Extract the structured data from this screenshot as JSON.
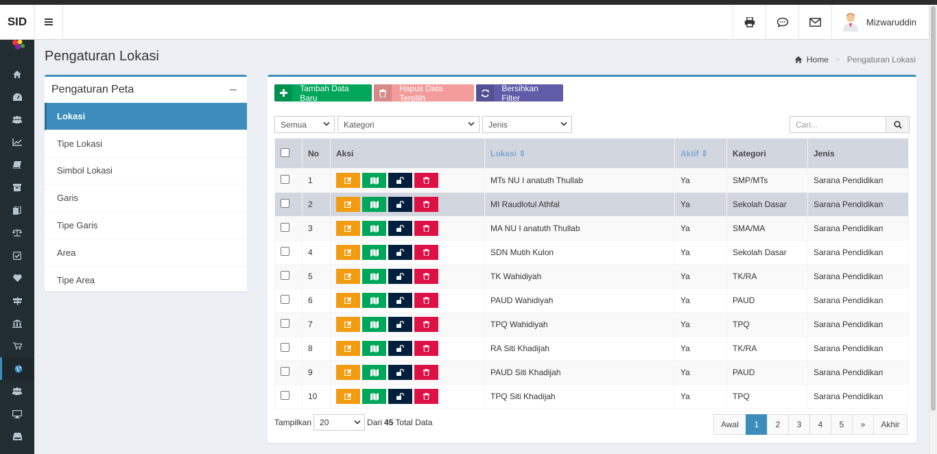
{
  "app": {
    "brand": "SID"
  },
  "user": {
    "name": "Mizwaruddin"
  },
  "page": {
    "title": "Pengaturan Lokasi"
  },
  "breadcrumb": {
    "home": "Home",
    "current": "Pengaturan Lokasi"
  },
  "left_panel": {
    "title": "Pengaturan Peta",
    "items": [
      {
        "label": "Lokasi",
        "active": true
      },
      {
        "label": "Tipe Lokasi"
      },
      {
        "label": "Simbol Lokasi"
      },
      {
        "label": "Garis"
      },
      {
        "label": "Tipe Garis"
      },
      {
        "label": "Area"
      },
      {
        "label": "Tipe Area"
      }
    ]
  },
  "toolbar": {
    "add_label": "Tambah Data Baru",
    "delete_label": "Hapus Data Terpilih",
    "clear_label": "Bersihkan Filter"
  },
  "filters": {
    "status": "Semua",
    "kategori": "Kategori",
    "jenis": "Jenis",
    "search_placeholder": "Cari..."
  },
  "table": {
    "headers": {
      "no": "No",
      "aksi": "Aksi",
      "lokasi": "Lokasi",
      "aktif": "Aktif",
      "kategori": "Kategori",
      "jenis": "Jenis"
    },
    "rows": [
      {
        "no": "1",
        "lokasi": "MTs NU I anatuth Thullab",
        "aktif": "Ya",
        "kategori": "SMP/MTs",
        "jenis": "Sarana Pendidikan"
      },
      {
        "no": "2",
        "lokasi": "MI Raudlotul Athfal",
        "aktif": "Ya",
        "kategori": "Sekolah Dasar",
        "jenis": "Sarana Pendidikan"
      },
      {
        "no": "3",
        "lokasi": "MA NU I anatuth Thullab",
        "aktif": "Ya",
        "kategori": "SMA/MA",
        "jenis": "Sarana Pendidikan"
      },
      {
        "no": "4",
        "lokasi": "SDN Mutih Kulon",
        "aktif": "Ya",
        "kategori": "Sekolah Dasar",
        "jenis": "Sarana Pendidikan"
      },
      {
        "no": "5",
        "lokasi": "TK Wahidiyah",
        "aktif": "Ya",
        "kategori": "TK/RA",
        "jenis": "Sarana Pendidikan"
      },
      {
        "no": "6",
        "lokasi": "PAUD Wahidiyah",
        "aktif": "Ya",
        "kategori": "PAUD",
        "jenis": "Sarana Pendidikan"
      },
      {
        "no": "7",
        "lokasi": "TPQ Wahidiyah",
        "aktif": "Ya",
        "kategori": "TPQ",
        "jenis": "Sarana Pendidikan"
      },
      {
        "no": "8",
        "lokasi": "RA Siti Khadijah",
        "aktif": "Ya",
        "kategori": "TK/RA",
        "jenis": "Sarana Pendidikan"
      },
      {
        "no": "9",
        "lokasi": "PAUD Siti Khadijah",
        "aktif": "Ya",
        "kategori": "PAUD",
        "jenis": "Sarana Pendidikan"
      },
      {
        "no": "10",
        "lokasi": "TPQ Siti Khadijah",
        "aktif": "Ya",
        "kategori": "TPQ",
        "jenis": "Sarana Pendidikan"
      }
    ]
  },
  "footer": {
    "show_label": "Tampilkan",
    "page_size": "20",
    "of_label": "Dari",
    "total": "45",
    "total_suffix": "Total Data"
  },
  "pagination": {
    "first": "Awal",
    "pages": [
      "1",
      "2",
      "3",
      "4",
      "5"
    ],
    "current": "1",
    "next": "»",
    "last": "Akhir"
  },
  "colors": {
    "primary": "#3c8dbc",
    "success": "#00a65a",
    "warning": "#f39c12",
    "danger": "#dd1144",
    "navy": "#001f3f",
    "purple": "#605ca8"
  }
}
